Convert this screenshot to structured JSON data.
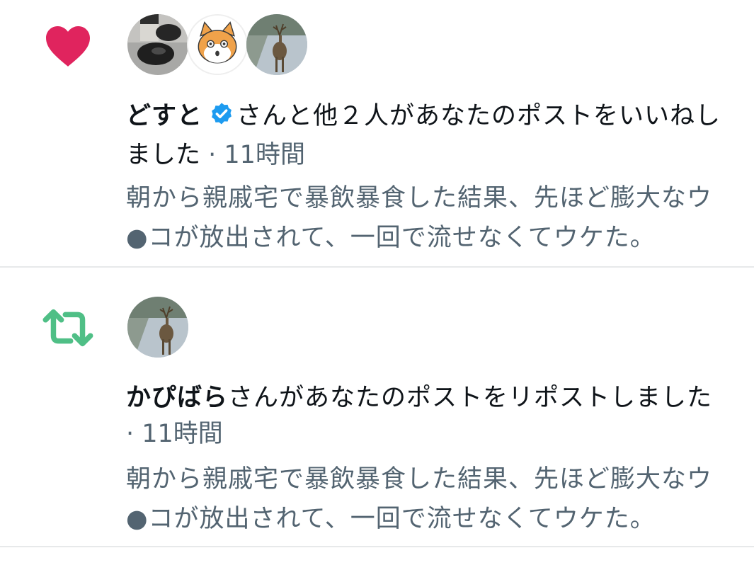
{
  "colors": {
    "like": "#e0245e",
    "repost": "#4fbf86",
    "verified": "#1d9bf0",
    "secondary_text": "#536471",
    "divider": "#e7e9ea"
  },
  "notifications": [
    {
      "type": "like",
      "icon": "heart-icon",
      "avatars": [
        "shoes-photo-avatar",
        "cat-illustration-avatar",
        "deer-photo-avatar"
      ],
      "user_name": "どすと",
      "verified": true,
      "action_text": "さんと他２人があなたのポストをいいねし",
      "action_text_cont": "ました",
      "time_sep": " · ",
      "time": "11時間",
      "post_lines": [
        "朝から親戚宅で暴飲暴食した結果、先ほど膨大なウ",
        "●コが放出されて、一回で流せなくてウケた。"
      ]
    },
    {
      "type": "repost",
      "icon": "retweet-icon",
      "avatars": [
        "deer-photo-avatar"
      ],
      "user_name": "かぴばら",
      "verified": false,
      "action_text": "さんがあなたのポストをリポストしました",
      "time_sep": "· ",
      "time": "11時間",
      "post_lines": [
        "朝から親戚宅で暴飲暴食した結果、先ほど膨大なウ",
        "●コが放出されて、一回で流せなくてウケた。"
      ]
    }
  ]
}
